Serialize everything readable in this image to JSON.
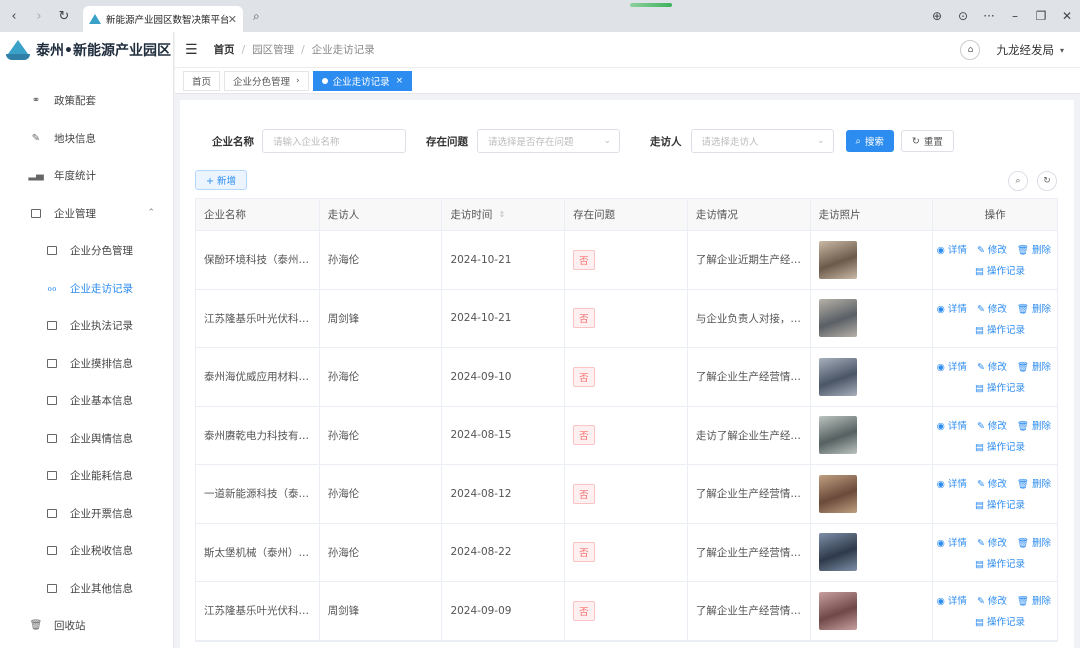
{
  "browser": {
    "tab_title": "新能源产业园区数智决策平台",
    "close": "✕",
    "back": "‹",
    "forward": "›",
    "reload": "↻",
    "search": "⌕",
    "right_icons": [
      "⊕",
      "⊙",
      "···",
      "–",
      "❐",
      "✕"
    ]
  },
  "sidebar": {
    "logo": "泰州•新能源产业园区",
    "items": [
      {
        "label": "政策配套",
        "icon": "🔗"
      },
      {
        "label": "地块信息",
        "icon": "✎"
      },
      {
        "label": "年度统计",
        "icon": "▮"
      },
      {
        "label": "企业管理",
        "icon": "▣",
        "caret": "⌃"
      }
    ],
    "sub_items": [
      {
        "label": "企业分色管理"
      },
      {
        "label": "企业走访记录",
        "active": true
      },
      {
        "label": "企业执法记录"
      },
      {
        "label": "企业摸排信息"
      },
      {
        "label": "企业基本信息"
      },
      {
        "label": "企业舆情信息"
      },
      {
        "label": "企业能耗信息"
      },
      {
        "label": "企业开票信息"
      },
      {
        "label": "企业税收信息"
      },
      {
        "label": "企业其他信息"
      }
    ],
    "recycle": "回收站"
  },
  "header": {
    "breadcrumb": [
      "首页",
      "园区管理",
      "企业走访记录"
    ],
    "sep": "/",
    "user": "九龙经发局",
    "hamburger": "☰",
    "bell": "⌂",
    "caret": "▾"
  },
  "tags": {
    "home": "首页",
    "tag2": "企业分色管理",
    "tag2_x": "›",
    "active": "企业走访记录",
    "active_x": "×"
  },
  "filters": {
    "name_label": "企业名称",
    "name_placeholder": "请输入企业名称",
    "problem_label": "存在问题",
    "problem_placeholder": "请选择是否存在问题",
    "visitor_label": "走访人",
    "visitor_placeholder": "请选择走访人",
    "search": "搜索",
    "reset": "重置",
    "chev": "⌄"
  },
  "toolbar": {
    "add": "+ 新增",
    "search_icon": "⌕",
    "refresh_icon": "↻"
  },
  "table": {
    "headers": [
      "企业名称",
      "走访人",
      "走访时间",
      "存在问题",
      "走访情况",
      "走访照片",
      "操作"
    ],
    "sort_icon": "⇕",
    "ops": {
      "detail": "◉ 详情",
      "edit": "✎ 修改",
      "delete": "🗑 删除",
      "log": "▤ 操作记录"
    },
    "rows": [
      {
        "name": "保酚环境科技（泰州…",
        "visitor": "孙海伦",
        "time": "2024-10-21",
        "problem": "否",
        "situation": "了解企业近期生产经…"
      },
      {
        "name": "江苏隆基乐叶光伏科…",
        "visitor": "周剑锋",
        "time": "2024-10-21",
        "problem": "否",
        "situation": "与企业负责人对接，…"
      },
      {
        "name": "泰州海优威应用材料…",
        "visitor": "孙海伦",
        "time": "2024-09-10",
        "problem": "否",
        "situation": "了解企业生产经营情…"
      },
      {
        "name": "泰州赓乾电力科技有…",
        "visitor": "孙海伦",
        "time": "2024-08-15",
        "problem": "否",
        "situation": "走访了解企业生产经…"
      },
      {
        "name": "一道新能源科技（泰…",
        "visitor": "孙海伦",
        "time": "2024-08-12",
        "problem": "否",
        "situation": "了解企业生产经营情…"
      },
      {
        "name": "斯太堡机械（泰州）…",
        "visitor": "孙海伦",
        "time": "2024-08-22",
        "problem": "否",
        "situation": "了解企业生产经营情…"
      },
      {
        "name": "江苏隆基乐叶光伏科…",
        "visitor": "周剑锋",
        "time": "2024-09-09",
        "problem": "否",
        "situation": "了解企业生产经营情…"
      }
    ]
  }
}
